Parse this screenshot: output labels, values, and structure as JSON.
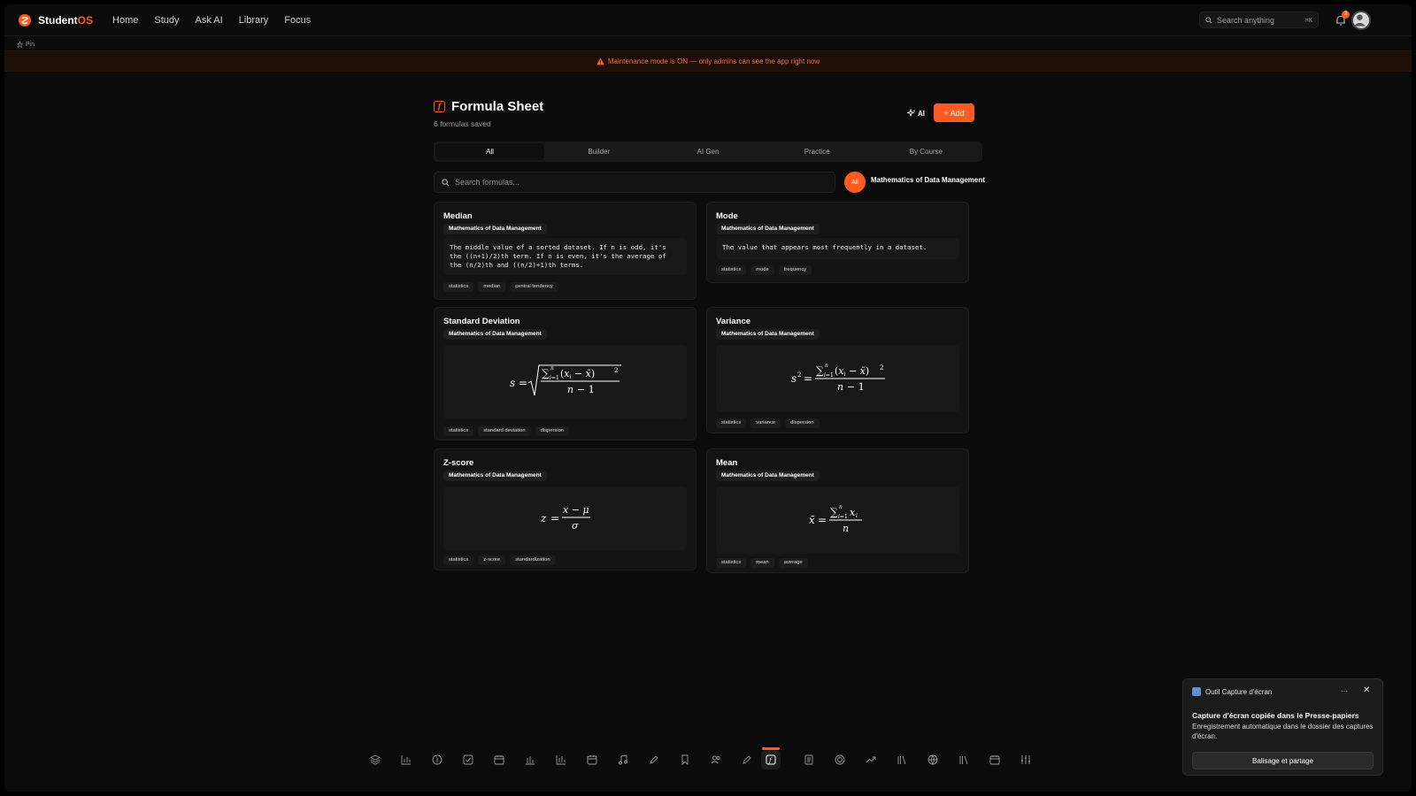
{
  "app": {
    "name_main": "Student",
    "name_accent": "OS"
  },
  "nav": [
    "Home",
    "Study",
    "Ask AI",
    "Library",
    "Focus"
  ],
  "search_top": {
    "placeholder": "Search anything",
    "shortcut": "⌘K"
  },
  "notifications": {
    "count": "3"
  },
  "pin": {
    "label": "Pin"
  },
  "banner": {
    "text": "Maintenance mode is ON — only admins can see the app right now"
  },
  "page": {
    "title": "Formula Sheet",
    "subtitle": "6 formulas saved",
    "ai_label": "AI",
    "add_label": "+ Add"
  },
  "tabs": [
    "All",
    "Builder",
    "AI Gen",
    "Practice",
    "By Course"
  ],
  "search": {
    "placeholder": "Search formulas..."
  },
  "filters": {
    "all_label": "All",
    "course_label": "Mathematics of Data Management"
  },
  "formulas": [
    {
      "title": "Median",
      "course": "Mathematics of Data Management",
      "description": "The middle value of a sorted dataset. If n is odd, it's the ((n+1)/2)th term. If n is even, it's the average of the (n/2)th and ((n/2)+1)th terms.",
      "tags": [
        "statistics",
        "median",
        "central tendency"
      ]
    },
    {
      "title": "Mode",
      "course": "Mathematics of Data Management",
      "description": "The value that appears most frequently in a dataset.",
      "tags": [
        "statistics",
        "mode",
        "frequency"
      ]
    },
    {
      "title": "Standard Deviation",
      "course": "Mathematics of Data Management",
      "latex": "s = sqrt( sum_{i=1}^{n} (x_i - x̄)^2 / (n - 1) )",
      "tags": [
        "statistics",
        "standard deviation",
        "dispersion"
      ]
    },
    {
      "title": "Variance",
      "course": "Mathematics of Data Management",
      "latex": "s^2 = sum_{i=1}^{n} (x_i - x̄)^2 / (n - 1)",
      "tags": [
        "statistics",
        "variance",
        "dispersion"
      ]
    },
    {
      "title": "Z-score",
      "course": "Mathematics of Data Management",
      "latex": "z = (x - μ) / σ",
      "tags": [
        "statistics",
        "z-score",
        "standardization"
      ]
    },
    {
      "title": "Mean",
      "course": "Mathematics of Data Management",
      "latex": "x̄ = sum_{i=1}^{n} x_i / n",
      "tags": [
        "statistics",
        "mean",
        "average"
      ]
    }
  ],
  "dock": {
    "icons": [
      "layers-icon",
      "bar-chart-icon",
      "compass-icon",
      "checkbox-icon",
      "calendar-icon",
      "bar-chart-icon",
      "bar-chart-icon",
      "calendar-icon",
      "music-icon",
      "pen-icon",
      "bookmark-icon",
      "users-icon",
      "pen-icon",
      "formula-icon",
      "document-icon",
      "target-icon",
      "trend-icon",
      "library-icon",
      "globe-icon",
      "library-icon",
      "calendar-icon",
      "sliders-icon"
    ],
    "active_index": 13
  },
  "toast": {
    "app_name": "Outil Capture d'écran",
    "title": "Capture d'écran copiée dans le Presse-papiers",
    "body": "Enregistrement automatique dans le dossier des captures d'écran.",
    "button": "Balisage et partage",
    "more": "···",
    "close": "✕"
  },
  "colors": {
    "accent": "#ff5a1f",
    "background": "#0b0b0b",
    "card": "#131313"
  }
}
